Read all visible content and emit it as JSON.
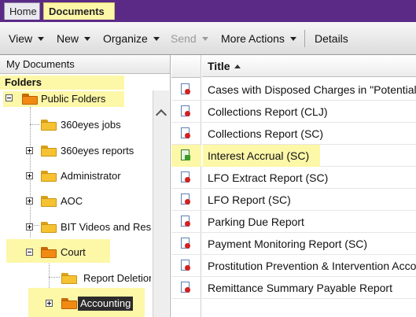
{
  "tabs": {
    "home": "Home",
    "documents": "Documents"
  },
  "toolbar": {
    "view": "View",
    "new": "New",
    "organize": "Organize",
    "send": "Send",
    "more_actions": "More Actions",
    "details": "Details"
  },
  "left_pane": {
    "my_documents": "My Documents",
    "folders": "Folders",
    "tree": {
      "public_folders": "Public Folders",
      "item_360eyes_jobs": "360eyes jobs",
      "item_360eyes_reports": "360eyes reports",
      "administrator": "Administrator",
      "aoc": "AOC",
      "bit_videos": "BIT Videos and Reso",
      "court": "Court",
      "report_deletion": "Report Deletion",
      "accounting": "Accounting"
    }
  },
  "documents": {
    "title_header": "Title",
    "rows": [
      "Cases with Disposed Charges in \"Potential\"",
      "Collections Report (CLJ)",
      "Collections Report (SC)",
      "Interest Accrual (SC)",
      "LFO Extract Report (SC)",
      "LFO Report (SC)",
      "Parking Due Report",
      "Payment Monitoring Report (SC)",
      "Prostitution Prevention & Intervention Acco",
      "Remittance Summary Payable Report"
    ]
  },
  "colors": {
    "highlight": "#fdf7a8",
    "tab_bar": "#5b2a86",
    "folder_orange": "#f08a12",
    "folder_yellow": "#f6c232"
  }
}
